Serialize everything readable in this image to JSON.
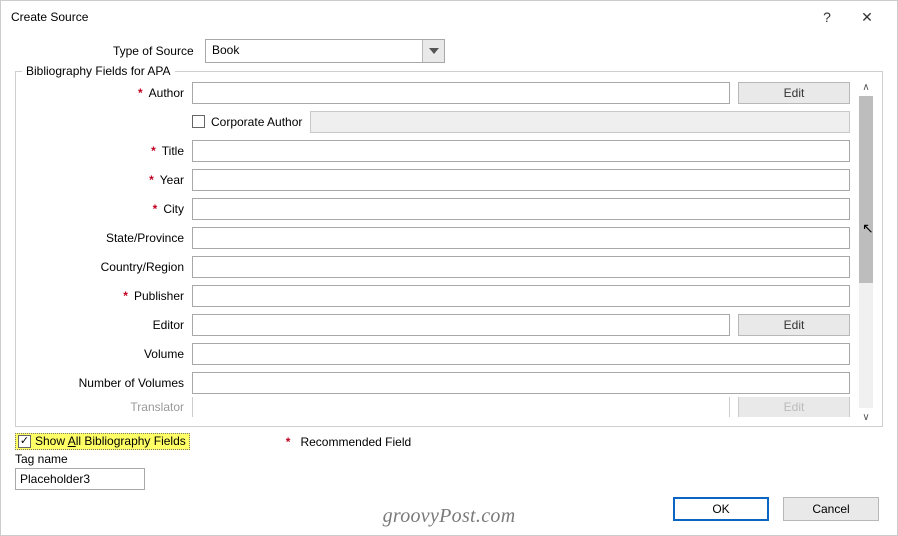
{
  "dialog": {
    "title": "Create Source",
    "help_icon": "?",
    "close_icon": "✕"
  },
  "type_of_source": {
    "label": "Type of Source",
    "value": "Book"
  },
  "fieldset": {
    "legend": "Bibliography Fields for APA"
  },
  "fields": {
    "author": {
      "label": "Author",
      "required": true,
      "value": "",
      "has_edit": true,
      "edit_label": "Edit"
    },
    "corporate_author": {
      "checkbox_label": "Corporate Author",
      "checked": false
    },
    "title": {
      "label": "Title",
      "required": true,
      "value": ""
    },
    "year": {
      "label": "Year",
      "required": true,
      "value": ""
    },
    "city": {
      "label": "City",
      "required": true,
      "value": ""
    },
    "state_province": {
      "label": "State/Province",
      "required": false,
      "value": ""
    },
    "country_region": {
      "label": "Country/Region",
      "required": false,
      "value": ""
    },
    "publisher": {
      "label": "Publisher",
      "required": true,
      "value": ""
    },
    "editor": {
      "label": "Editor",
      "required": false,
      "value": "",
      "has_edit": true,
      "edit_label": "Edit"
    },
    "volume": {
      "label": "Volume",
      "required": false,
      "value": ""
    },
    "number_of_volumes": {
      "label": "Number of Volumes",
      "required": false,
      "value": ""
    },
    "translator": {
      "label": "Translator",
      "required": false,
      "value": "",
      "has_edit": true,
      "edit_label": "Edit"
    }
  },
  "show_all": {
    "checked": true,
    "label_pre": "Show ",
    "label_underline": "A",
    "label_post": "ll Bibliography Fields"
  },
  "recommended": {
    "star": "*",
    "label": "Recommended Field"
  },
  "tag": {
    "label": "Tag name",
    "value": "Placeholder3"
  },
  "buttons": {
    "ok": "OK",
    "cancel": "Cancel"
  },
  "watermark": "groovyPost.com"
}
